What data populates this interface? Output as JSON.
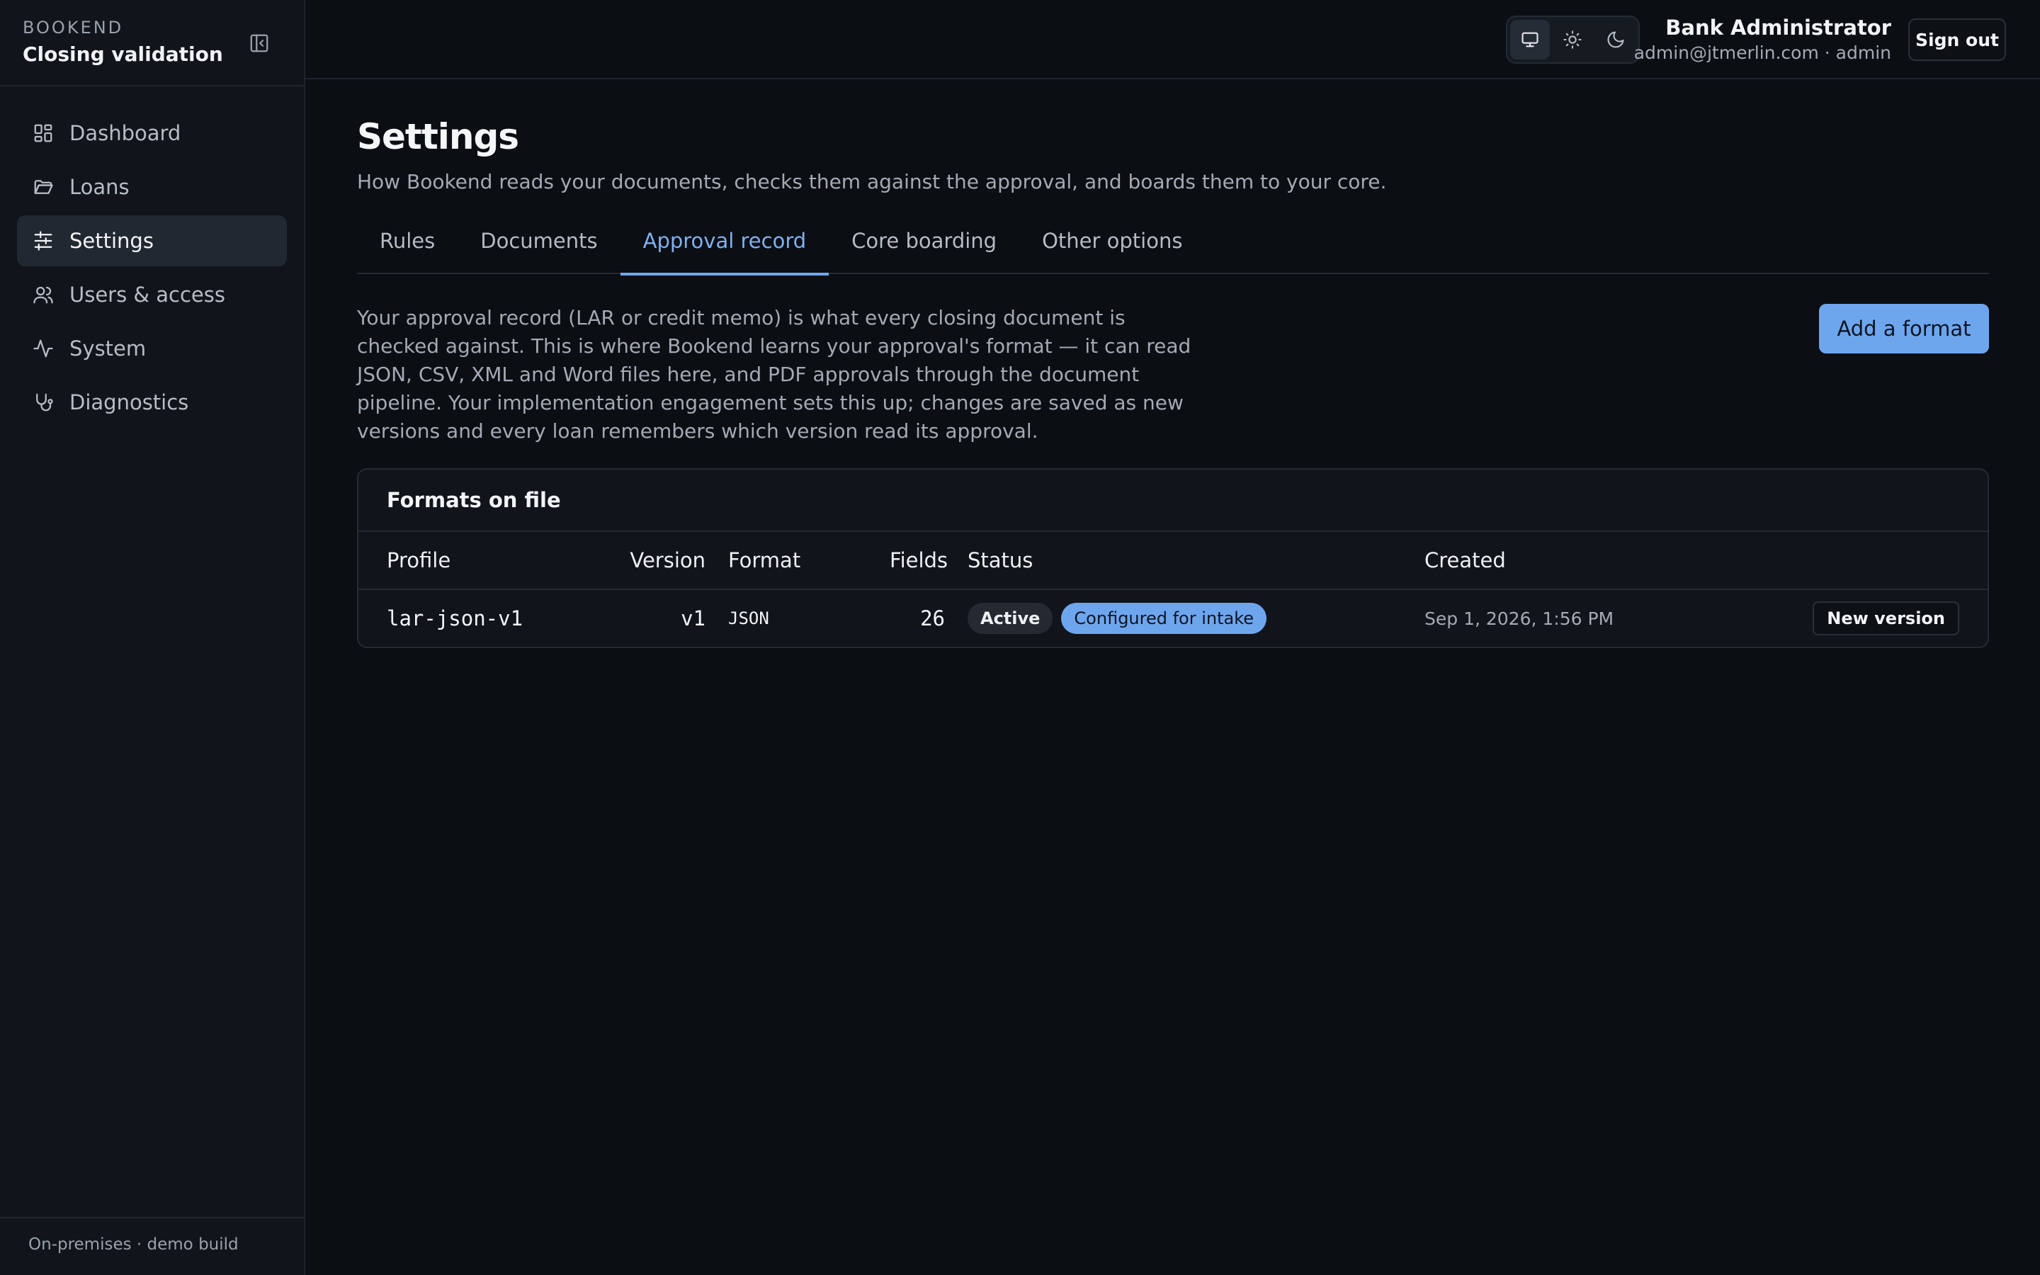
{
  "sidebar": {
    "brand_small": "BOOKEND",
    "brand_title": "Closing validation",
    "collapse_icon": "sidebar-collapse-icon",
    "items": [
      {
        "label": "Dashboard",
        "icon": "dashboard-icon"
      },
      {
        "label": "Loans",
        "icon": "folder-icon"
      },
      {
        "label": "Settings",
        "icon": "sliders-icon",
        "active": true
      },
      {
        "label": "Users & access",
        "icon": "users-icon"
      },
      {
        "label": "System",
        "icon": "activity-icon"
      },
      {
        "label": "Diagnostics",
        "icon": "stethoscope-icon"
      }
    ],
    "footer": "On-premises · demo build"
  },
  "topbar": {
    "theme_options": [
      "monitor-icon",
      "sun-icon",
      "moon-icon"
    ],
    "theme_selected": "monitor-icon",
    "user_name": "Bank Administrator",
    "user_meta": "admin@jtmerlin.com · admin",
    "signout_label": "Sign out"
  },
  "page": {
    "title": "Settings",
    "subtitle": "How Bookend reads your documents, checks them against the approval, and boards them to your core.",
    "tabs": [
      {
        "label": "Rules"
      },
      {
        "label": "Documents"
      },
      {
        "label": "Approval record",
        "active": true
      },
      {
        "label": "Core boarding"
      },
      {
        "label": "Other options"
      }
    ],
    "intro": "Your approval record (LAR or credit memo) is what every closing document is checked against. This is where Bookend learns your approval's format — it can read JSON, CSV, XML and Word files here, and PDF approvals through the document pipeline. Your implementation engagement sets this up; changes are saved as new versions and every loan remembers which version read its approval.",
    "add_format_label": "Add a format"
  },
  "formats": {
    "card_title": "Formats on file",
    "columns": {
      "profile": "Profile",
      "version": "Version",
      "format": "Format",
      "fields": "Fields",
      "status": "Status",
      "created": "Created"
    },
    "rows": [
      {
        "profile": "lar-json-v1",
        "version": "v1",
        "format": "JSON",
        "fields": "26",
        "status": "Active",
        "status_extra": "Configured for intake",
        "created": "Sep 1, 2026, 1:56 PM",
        "action": "New version"
      }
    ]
  },
  "colors": {
    "accent": "#6ea6ee",
    "background": "#0b0e13",
    "sidebar": "#11151b"
  }
}
